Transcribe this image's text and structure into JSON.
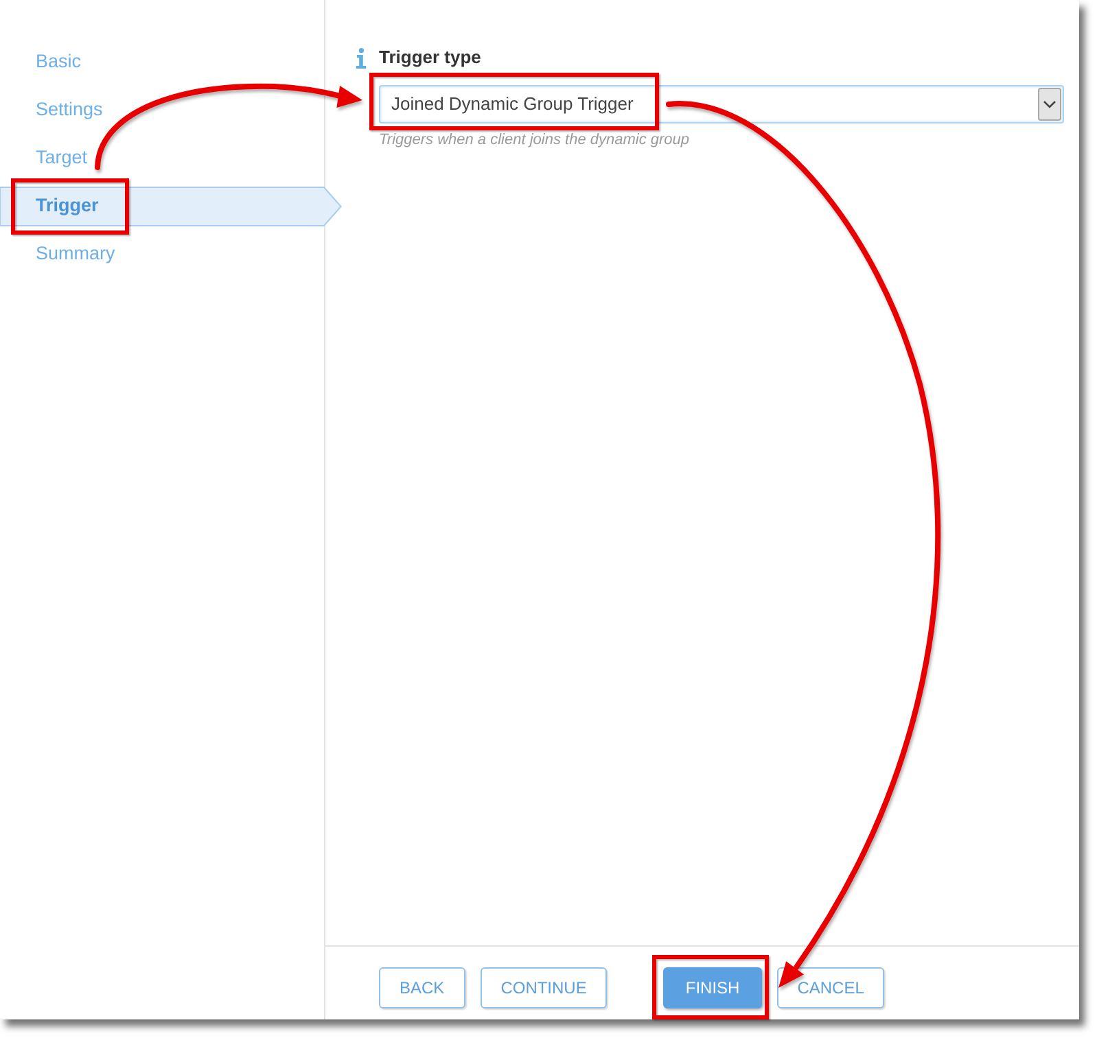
{
  "sidebar": {
    "items": [
      {
        "label": "Basic",
        "selected": false
      },
      {
        "label": "Settings",
        "selected": false
      },
      {
        "label": "Target",
        "selected": false
      },
      {
        "label": "Trigger",
        "selected": true
      },
      {
        "label": "Summary",
        "selected": false
      }
    ]
  },
  "field": {
    "label": "Trigger type",
    "value": "Joined Dynamic Group Trigger",
    "hint": "Triggers when a client joins the dynamic group"
  },
  "footer": {
    "navigation": [
      {
        "label": "BACK",
        "kind": "default"
      },
      {
        "label": "CONTINUE",
        "kind": "default"
      }
    ],
    "actions": [
      {
        "label": "FINISH",
        "kind": "primary"
      },
      {
        "label": "CANCEL",
        "kind": "default"
      }
    ]
  }
}
